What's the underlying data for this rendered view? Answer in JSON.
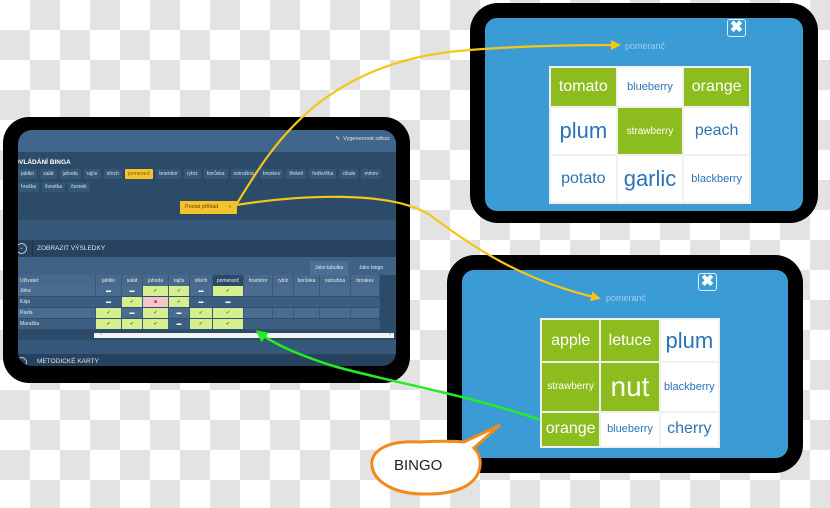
{
  "colors": {
    "yellow_arrow": "#f5c518",
    "green_arrow": "#22ee22",
    "bubble_border": "#f08a1c",
    "tablet_screen_blue": "#3a9bd5",
    "selected_cell_green": "#8cbc1d"
  },
  "teacher_panel": {
    "generate_link_icon": "link-icon",
    "generate_link": "Vygenerovat odkaz",
    "control_heading": "OVLÁDÁNÍ BINGA",
    "words": [
      "jablko",
      "salát",
      "jahoda",
      "rajče",
      "ořech",
      "pomeranč",
      "brambor",
      "rybíz",
      "borůvka",
      "ostružina",
      "broskev",
      "třešeň",
      "ředkvička",
      "cibule",
      "mrkev",
      "hruška",
      "švestka",
      "česnek"
    ],
    "selected_word": "pomeranč",
    "send_button": "Poslat příklad",
    "send_chevron": "›",
    "results_section": "ZOBRAZIT VÝSLEDKY",
    "results_icon": "chevron-down-circle-icon",
    "view_tabs": [
      "Jako tabulka",
      "Jako bingo"
    ],
    "active_tab": "Jako tabulka",
    "table": {
      "user_header": "Uživatel:",
      "columns": [
        "jablko",
        "salát",
        "jahoda",
        "rajče",
        "ořech",
        "pomeranč",
        "brambor",
        "rybíz",
        "borůvka",
        "ostružina",
        "broskev"
      ],
      "rows": [
        {
          "user": "Jirka",
          "cells": [
            "-",
            "-",
            "ok",
            "ok",
            "-",
            "ok",
            "",
            "",
            "",
            "",
            ""
          ]
        },
        {
          "user": "Kája",
          "cells": [
            "-",
            "ok",
            "x",
            "ok",
            "-",
            "-",
            "",
            "",
            "",
            "",
            ""
          ]
        },
        {
          "user": "Pavla",
          "cells": [
            "ok",
            "-",
            "ok",
            "-",
            "ok",
            "ok",
            "",
            "",
            "",
            "",
            ""
          ]
        },
        {
          "user": "Maruška",
          "cells": [
            "ok",
            "ok",
            "ok",
            "-",
            "ok",
            "ok",
            "",
            "",
            "",
            "",
            ""
          ]
        }
      ]
    },
    "scroll_left": "‹",
    "scroll_right": "›",
    "methodology_section": "METODICKÉ KARTY"
  },
  "student_tablet_1": {
    "close_icon": "close-icon",
    "close_glyph": "✖",
    "current_word": "pomeranč",
    "cells": [
      {
        "word": "tomato",
        "marked": true,
        "size": "l"
      },
      {
        "word": "blueberry",
        "marked": false,
        "size": "s"
      },
      {
        "word": "orange",
        "marked": true,
        "size": "l"
      },
      {
        "word": "plum",
        "marked": false,
        "size": "xl"
      },
      {
        "word": "strawberry",
        "marked": true,
        "size": "xs"
      },
      {
        "word": "peach",
        "marked": false,
        "size": "l"
      },
      {
        "word": "potato",
        "marked": false,
        "size": "l"
      },
      {
        "word": "garlic",
        "marked": false,
        "size": "xl"
      },
      {
        "word": "blackberry",
        "marked": false,
        "size": "s"
      }
    ]
  },
  "student_tablet_2": {
    "close_icon": "close-icon",
    "close_glyph": "✖",
    "current_word": "pomeranč",
    "cells": [
      {
        "word": "apple",
        "marked": true,
        "size": "l"
      },
      {
        "word": "letuce",
        "marked": true,
        "size": "l"
      },
      {
        "word": "plum",
        "marked": false,
        "size": "xl"
      },
      {
        "word": "strawberry",
        "marked": true,
        "size": "xs"
      },
      {
        "word": "nut",
        "marked": true,
        "size": "xxl"
      },
      {
        "word": "blackberry",
        "marked": false,
        "size": "s"
      },
      {
        "word": "orange",
        "marked": true,
        "size": "m"
      },
      {
        "word": "blueberry",
        "marked": false,
        "size": "s"
      },
      {
        "word": "cherry",
        "marked": false,
        "size": "l"
      }
    ]
  },
  "callout": {
    "text": "BINGO"
  }
}
